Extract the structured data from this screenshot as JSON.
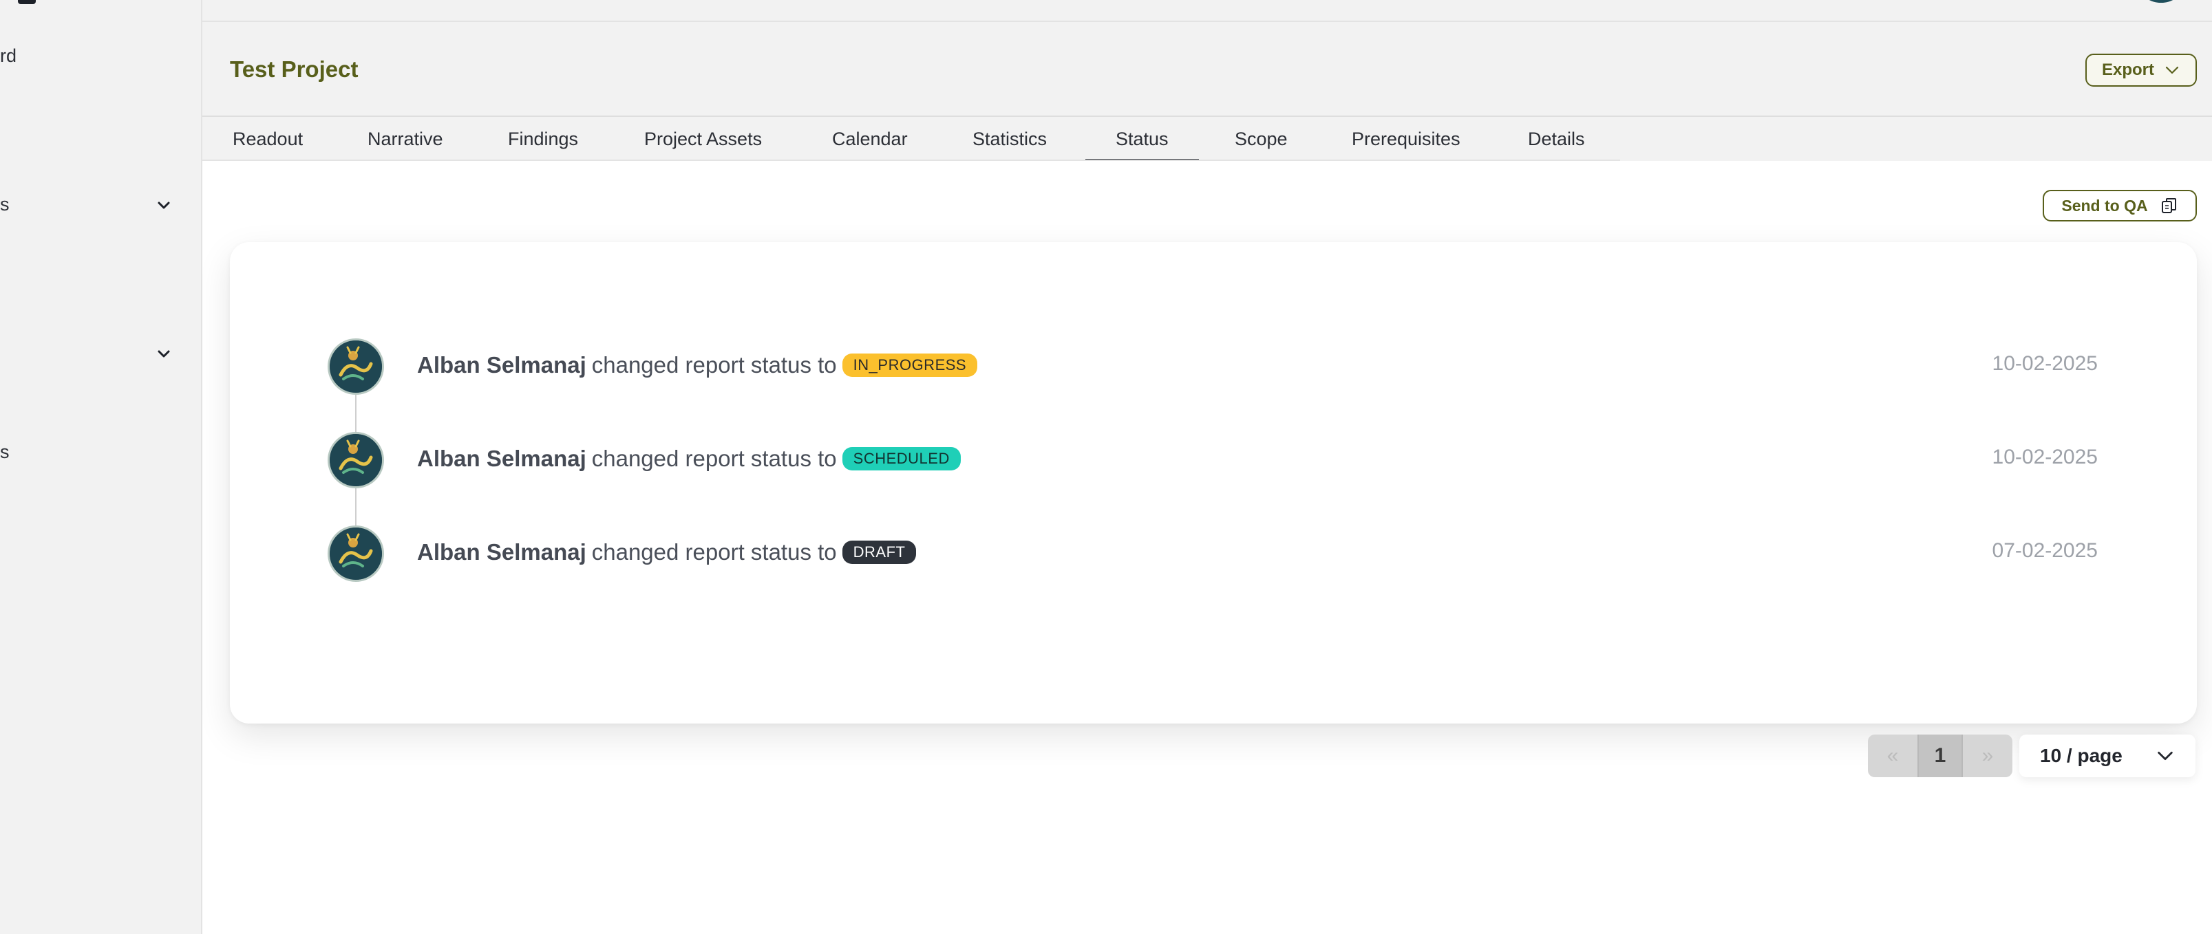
{
  "sidebar": {
    "items": [
      {
        "label": "rd",
        "has_chevron": false
      },
      {
        "label": "s",
        "has_chevron": true
      },
      {
        "label": "",
        "has_chevron": true
      },
      {
        "label": "s",
        "has_chevron": false
      }
    ]
  },
  "header": {
    "title": "Test Project",
    "export_label": "Export"
  },
  "tabs": [
    {
      "label": "Readout"
    },
    {
      "label": "Narrative"
    },
    {
      "label": "Findings"
    },
    {
      "label": "Project Assets"
    },
    {
      "label": "Calendar"
    },
    {
      "label": "Statistics"
    },
    {
      "label": "Status",
      "active": true
    },
    {
      "label": "Scope"
    },
    {
      "label": "Prerequisites"
    },
    {
      "label": "Details"
    }
  ],
  "main": {
    "send_to_qa_label": "Send to QA",
    "timeline": [
      {
        "user": "Alban Selmanaj",
        "action": "changed report status to",
        "status": "IN_PROGRESS",
        "status_bg": "#fbc02d",
        "status_fg": "#2a2a2a",
        "date": "10-02-2025"
      },
      {
        "user": "Alban Selmanaj",
        "action": "changed report status to",
        "status": "SCHEDULED",
        "status_bg": "#1fcfb7",
        "status_fg": "#123330",
        "date": "10-02-2025"
      },
      {
        "user": "Alban Selmanaj",
        "action": "changed report status to",
        "status": "DRAFT",
        "status_bg": "#2e333b",
        "status_fg": "#ffffff",
        "date": "07-02-2025"
      }
    ],
    "pagination": {
      "prev": "«",
      "current": "1",
      "next": "»",
      "page_size": "10 / page"
    }
  },
  "colors": {
    "brand": "#585f1b",
    "sidebar_bg": "#f2f2f2"
  }
}
